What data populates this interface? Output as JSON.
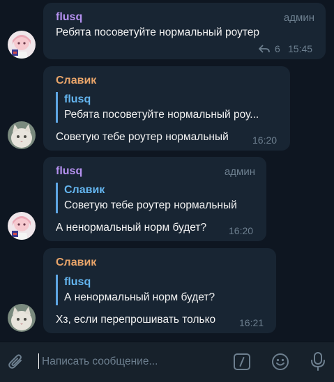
{
  "messages": [
    {
      "author": "flusq",
      "role": "админ",
      "text": "Ребята посоветуйте нормальный роутер",
      "replies_count": "6",
      "time": "15:45"
    },
    {
      "author": "Славик",
      "reply_to_author": "flusq",
      "reply_to_text": "Ребята посоветуйте нормальный роу...",
      "text": "Советую тебе роутер нормальный",
      "time": "16:20"
    },
    {
      "author": "flusq",
      "role": "админ",
      "reply_to_author": "Славик",
      "reply_to_text": "Советую тебе роутер нормальный",
      "text": "А ненормальный норм будет?",
      "time": "16:20"
    },
    {
      "author": "Славик",
      "reply_to_author": "flusq",
      "reply_to_text": "А ненормальный норм будет?",
      "text": "Хз, если перепрошивать только",
      "time": "16:21"
    }
  ],
  "composer": {
    "placeholder": "Написать сообщение..."
  },
  "colors": {
    "background": "#0e1621",
    "bubble": "#182533",
    "author_flusq": "#b591f0",
    "author_slavik": "#e9a56a",
    "reply_accent": "#5ea5e3"
  },
  "icons": [
    "reply-arrow-icon",
    "paperclip-icon",
    "bot-commands-icon",
    "emoji-icon",
    "microphone-icon"
  ]
}
